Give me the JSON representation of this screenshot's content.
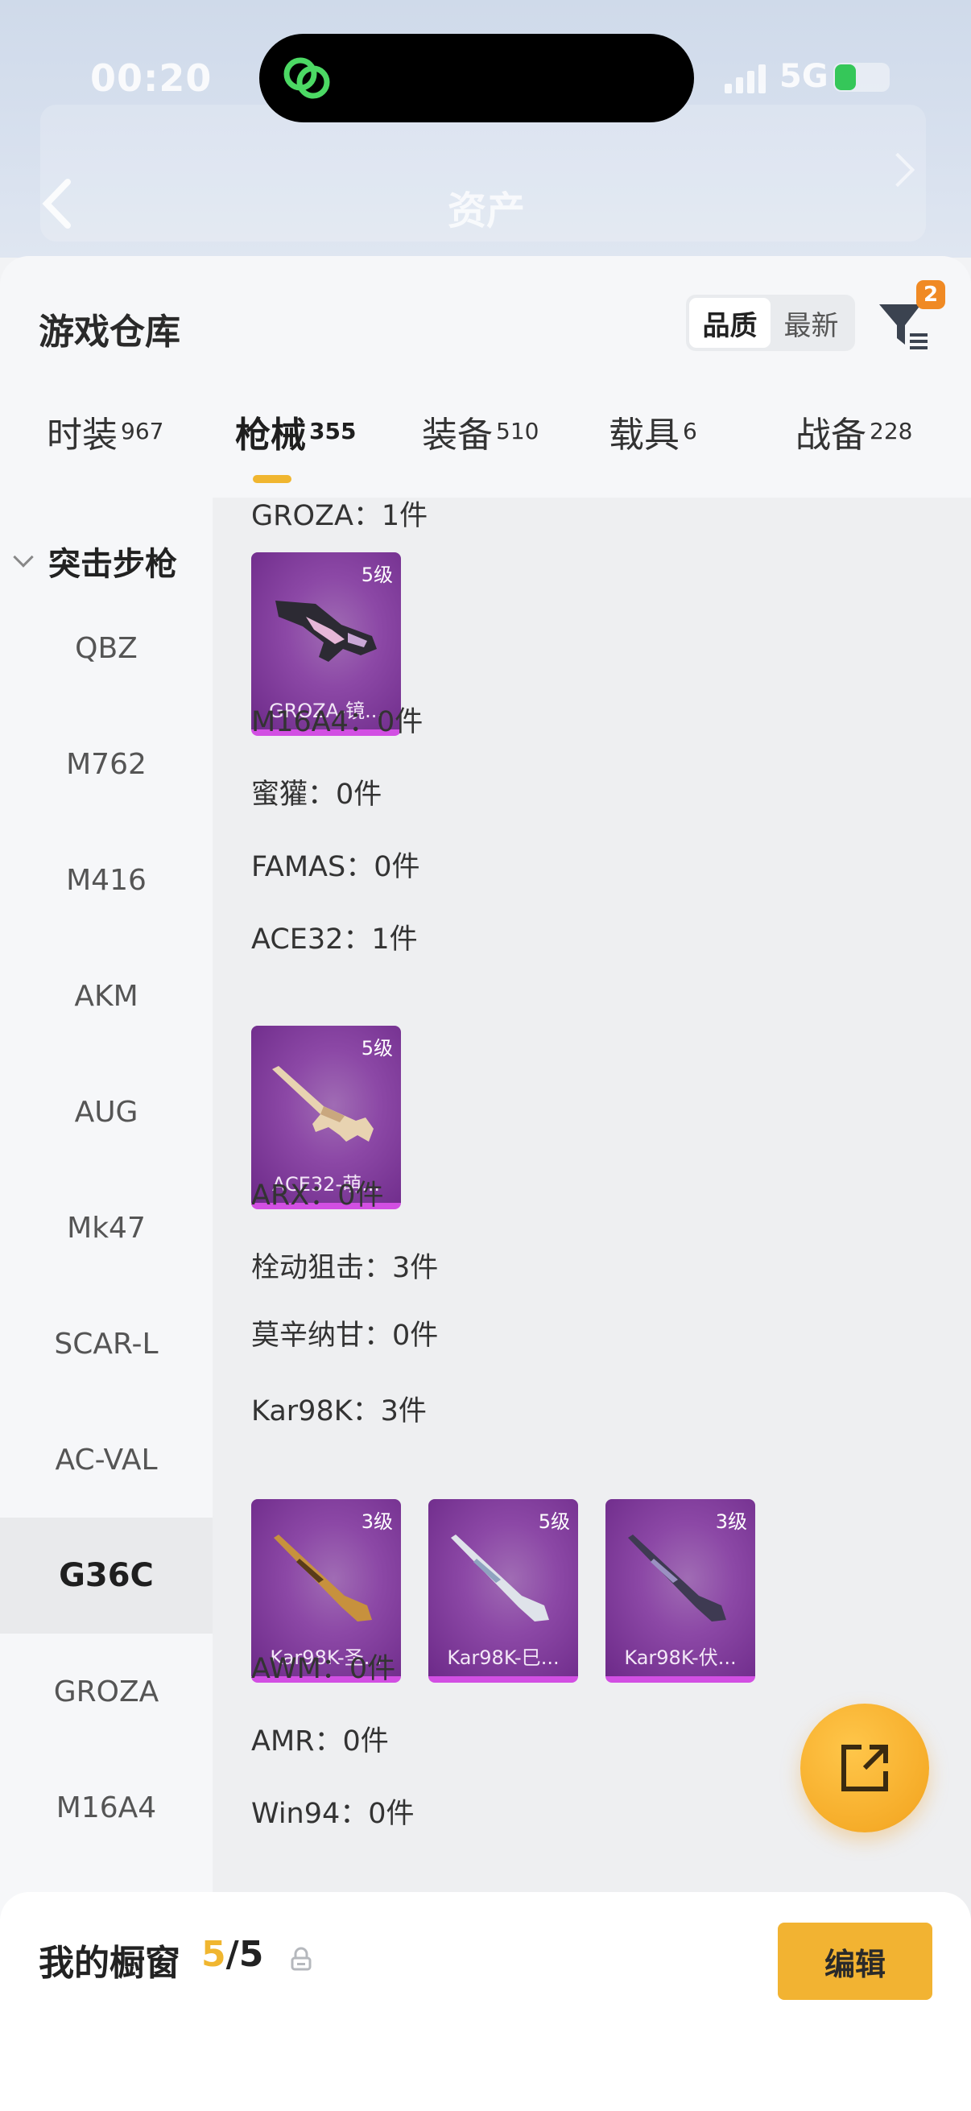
{
  "status": {
    "time": "00:20",
    "network": "5G"
  },
  "header": {
    "title": "资产"
  },
  "warehouse": {
    "title": "游戏仓库",
    "sort_options": [
      "品质",
      "最新"
    ],
    "filter_badge": "2"
  },
  "tabs": [
    {
      "label": "时装",
      "count": "967"
    },
    {
      "label": "枪械",
      "count": "355"
    },
    {
      "label": "装备",
      "count": "510"
    },
    {
      "label": "载具",
      "count": "6"
    },
    {
      "label": "战备",
      "count": "228"
    }
  ],
  "sidebar": {
    "category": "突击步枪",
    "items": [
      "QBZ",
      "M762",
      "M416",
      "AKM",
      "AUG",
      "Mk47",
      "SCAR-L",
      "AC-VAL",
      "G36C",
      "GROZA",
      "M16A4"
    ],
    "active_item": "G36C"
  },
  "content": {
    "rows": [
      {
        "label": "GROZA：1件"
      },
      {
        "label": "M16A4：0件"
      },
      {
        "label": "蜜獾：0件"
      },
      {
        "label": "FAMAS：0件"
      },
      {
        "label": "ACE32：1件"
      },
      {
        "label": "ARX：0件"
      },
      {
        "label": "栓动狙击：3件"
      },
      {
        "label": "莫辛纳甘：0件"
      },
      {
        "label": "Kar98K：3件"
      },
      {
        "label": "AWM：0件"
      },
      {
        "label": "AMR：0件"
      },
      {
        "label": "Win94：0件"
      }
    ],
    "cards": [
      {
        "grade": "5级",
        "name": "GROZA-镜..."
      },
      {
        "grade": "5级",
        "name": "ACE32-萌..."
      },
      {
        "grade": "3级",
        "name": "Kar98K-圣..."
      },
      {
        "grade": "5级",
        "name": "Kar98K-巳..."
      },
      {
        "grade": "3级",
        "name": "Kar98K-伏..."
      }
    ]
  },
  "showcase": {
    "label": "我的橱窗",
    "current": "5",
    "total": "/5",
    "edit_label": "编辑"
  },
  "colors": {
    "accent": "#f0b630",
    "card_purple": "#8c48a6",
    "card_border": "#d24fe3"
  }
}
